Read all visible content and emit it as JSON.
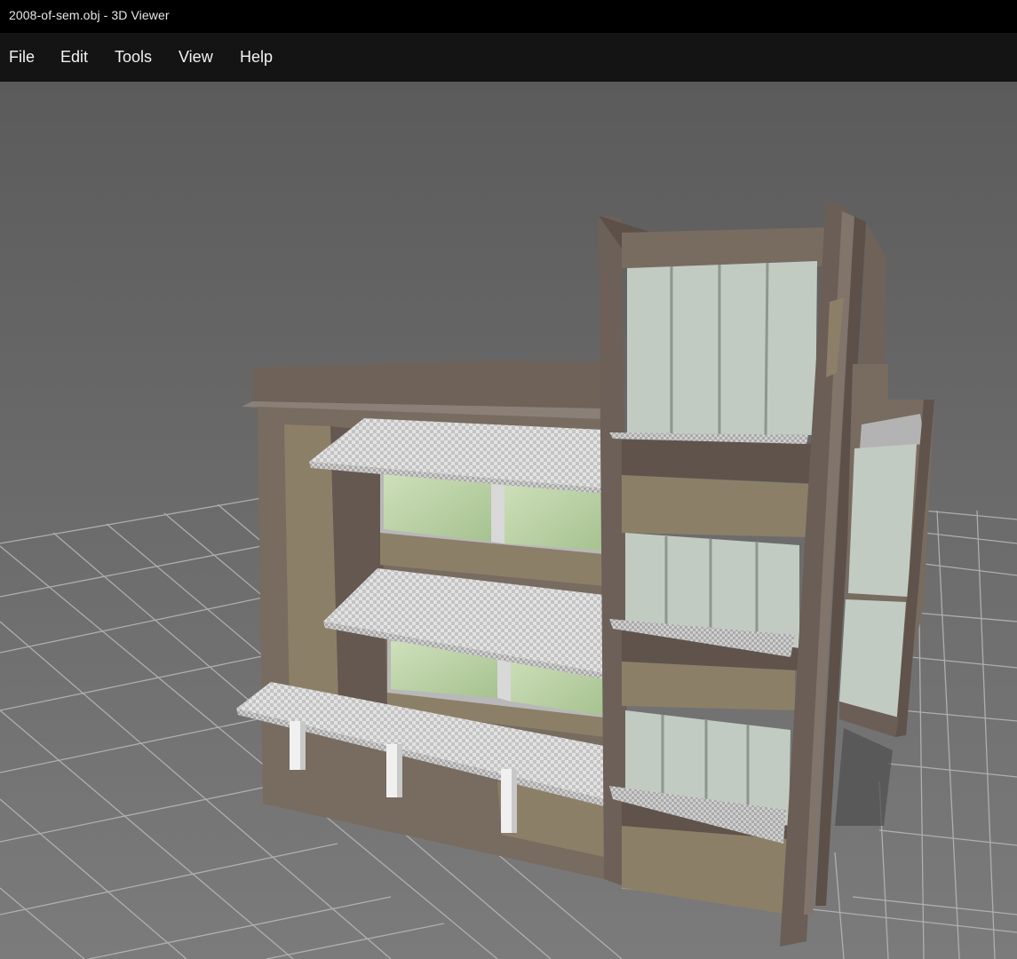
{
  "window": {
    "title": "2008-of-sem.obj - 3D Viewer"
  },
  "menu": [
    {
      "id": "file",
      "label": "File"
    },
    {
      "id": "edit",
      "label": "Edit"
    },
    {
      "id": "tools",
      "label": "Tools"
    },
    {
      "id": "view",
      "label": "View"
    },
    {
      "id": "help",
      "label": "Help"
    }
  ],
  "viewport": {
    "model_file": "2008-of-sem.obj",
    "colors": {
      "background_top": "#5b5b5b",
      "background_bottom": "#7a7a7a",
      "grid_line": "#b4b4b4",
      "wall_main": "#786b60",
      "wall_shade": "#5f534b",
      "wall_accent": "#8c7f68",
      "glass_green": "#b9d0a4",
      "glass_panel": "#c2cbc2",
      "canopy": "#dcdcdc"
    }
  }
}
